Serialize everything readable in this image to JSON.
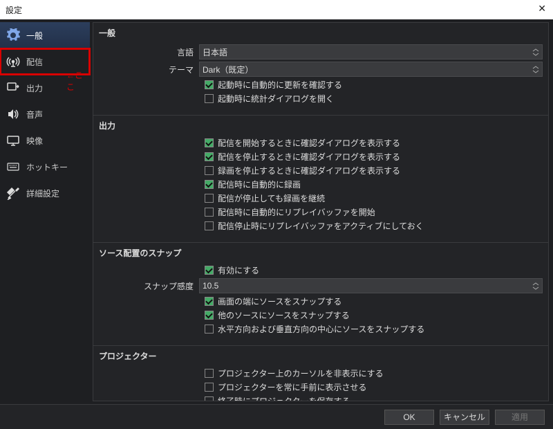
{
  "window": {
    "title": "設定"
  },
  "annotation": "←ここ",
  "sidebar": {
    "items": [
      {
        "label": "一般",
        "icon": "gear-icon",
        "active": true,
        "highlighted": false
      },
      {
        "label": "配信",
        "icon": "stream-icon",
        "active": false,
        "highlighted": true
      },
      {
        "label": "出力",
        "icon": "output-icon",
        "active": false,
        "highlighted": false
      },
      {
        "label": "音声",
        "icon": "audio-icon",
        "active": false,
        "highlighted": false
      },
      {
        "label": "映像",
        "icon": "video-icon",
        "active": false,
        "highlighted": false
      },
      {
        "label": "ホットキー",
        "icon": "hotkey-icon",
        "active": false,
        "highlighted": false
      },
      {
        "label": "詳細設定",
        "icon": "advanced-icon",
        "active": false,
        "highlighted": false
      }
    ]
  },
  "groups": {
    "general": {
      "title": "一般",
      "language_label": "言語",
      "language_value": "日本語",
      "theme_label": "テーマ",
      "theme_value": "Dark（既定）",
      "checks": [
        {
          "label": "起動時に自動的に更新を確認する",
          "checked": true
        },
        {
          "label": "起動時に統計ダイアログを開く",
          "checked": false
        }
      ]
    },
    "output": {
      "title": "出力",
      "checks": [
        {
          "label": "配信を開始するときに確認ダイアログを表示する",
          "checked": true
        },
        {
          "label": "配信を停止するときに確認ダイアログを表示する",
          "checked": true
        },
        {
          "label": "録画を停止するときに確認ダイアログを表示する",
          "checked": false
        },
        {
          "label": "配信時に自動的に録画",
          "checked": true
        },
        {
          "label": "配信が停止しても録画を継続",
          "checked": false
        },
        {
          "label": "配信時に自動的にリプレイバッファを開始",
          "checked": false
        },
        {
          "label": "配信停止時にリプレイバッファをアクティブにしておく",
          "checked": false
        }
      ]
    },
    "snap": {
      "title": "ソース配置のスナップ",
      "enable_label": "有効にする",
      "enable_checked": true,
      "sensitivity_label": "スナップ感度",
      "sensitivity_value": "10.5",
      "checks": [
        {
          "label": "画面の端にソースをスナップする",
          "checked": true
        },
        {
          "label": "他のソースにソースをスナップする",
          "checked": true
        },
        {
          "label": "水平方向および垂直方向の中心にソースをスナップする",
          "checked": false
        }
      ]
    },
    "projector": {
      "title": "プロジェクター",
      "checks": [
        {
          "label": "プロジェクター上のカーソルを非表示にする",
          "checked": false
        },
        {
          "label": "プロジェクターを常に手前に表示させる",
          "checked": false
        },
        {
          "label": "終了時にプロジェクターを保存する",
          "checked": false
        }
      ]
    }
  },
  "footer": {
    "ok": "OK",
    "cancel": "キャンセル",
    "apply": "適用"
  }
}
